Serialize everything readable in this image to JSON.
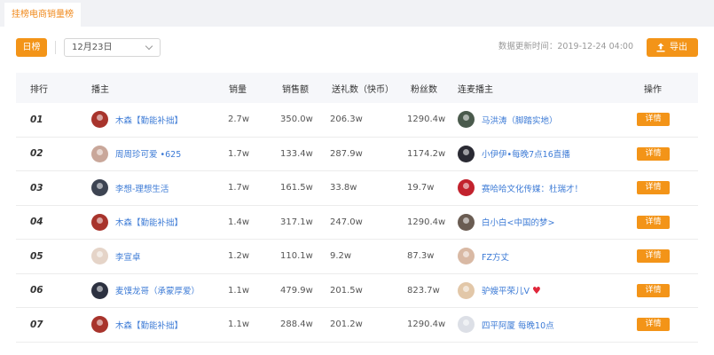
{
  "tab": {
    "label": "挂榜电商销量榜"
  },
  "toolbar": {
    "daily_label": "日榜",
    "date_value": "12月23日",
    "update_time": "数据更新时间：2019-12-24 04:00",
    "export_label": "导出"
  },
  "table": {
    "headers": {
      "rank": "排行",
      "anchor": "播主",
      "sales": "销量",
      "amount": "销售额",
      "gifts": "送礼数（快币）",
      "fans": "粉丝数",
      "linked": "连麦播主",
      "op": "操作"
    },
    "detail_label": "详情",
    "rows": [
      {
        "rank": "01",
        "anchor": "木森【勤能补拙】",
        "sales": "2.7w",
        "amount": "350.0w",
        "gifts": "206.3w",
        "fans": "1290.4w",
        "linked": "马洪涛（脚踏实地）",
        "anchor_color": "#a8342c",
        "linked_color": "#4a5a4c"
      },
      {
        "rank": "02",
        "anchor": "周周珍可爱 •625",
        "sales": "1.7w",
        "amount": "133.4w",
        "gifts": "287.9w",
        "fans": "1174.2w",
        "linked": "小伊伊•每晚7点16直播",
        "anchor_color": "#c9a79a",
        "linked_color": "#2a2a33"
      },
      {
        "rank": "03",
        "anchor": "李想-理想生活",
        "sales": "1.7w",
        "amount": "161.5w",
        "gifts": "33.8w",
        "fans": "19.7w",
        "linked": "赛哈哈文化传媒：杜瑞才！",
        "anchor_color": "#3d4452",
        "linked_color": "#c2222d"
      },
      {
        "rank": "04",
        "anchor": "木森【勤能补拙】",
        "sales": "1.4w",
        "amount": "317.1w",
        "gifts": "247.0w",
        "fans": "1290.4w",
        "linked": "白小白<中国的梦>",
        "anchor_color": "#a8342c",
        "linked_color": "#6a5c52"
      },
      {
        "rank": "05",
        "anchor": "李宣卓",
        "sales": "1.2w",
        "amount": "110.1w",
        "gifts": "9.2w",
        "fans": "87.3w",
        "linked": "FZ方丈",
        "anchor_color": "#e5d4c8",
        "linked_color": "#d9b9a4"
      },
      {
        "rank": "06",
        "anchor": "麦馍龙哥（承蒙厚爱）",
        "sales": "1.1w",
        "amount": "479.9w",
        "gifts": "201.5w",
        "fans": "823.7w",
        "linked": "驴嫂平荣儿V",
        "anchor_color": "#2c3140",
        "linked_color": "#e2c7a8"
      },
      {
        "rank": "07",
        "anchor": "木森【勤能补拙】",
        "sales": "1.1w",
        "amount": "288.4w",
        "gifts": "201.2w",
        "fans": "1290.4w",
        "linked": "四平阿厦 每晚10点",
        "anchor_color": "#a8342c",
        "linked_color": "#dcdfe6"
      }
    ]
  },
  "colors": {
    "accent": "#f39418",
    "link": "#3d7bd6",
    "heart": "#e0263a"
  }
}
